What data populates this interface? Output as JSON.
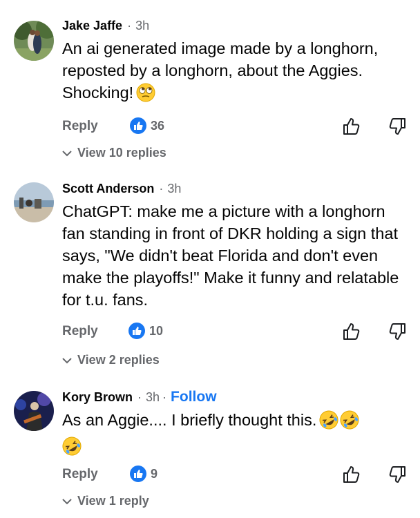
{
  "comments": [
    {
      "author": "Jake Jaffe",
      "time": "3h",
      "text": "An ai generated image made by a longhorn, reposted by a longhorn, about the Aggies. Shocking!",
      "emojis": [
        "face-with-rolling-eyes"
      ],
      "reply_label": "Reply",
      "likes": "36",
      "view_replies": "View 10 replies"
    },
    {
      "author": "Scott Anderson",
      "time": "3h",
      "text": "ChatGPT:  make me a picture with a longhorn fan standing in front of DKR holding a sign that says, \"We didn't beat Florida and don't even make the playoffs!\" Make it funny and relatable for t.u. fans.",
      "reply_label": "Reply",
      "likes": "10",
      "view_replies": "View 2 replies"
    },
    {
      "author": "Kory Brown",
      "time": "3h",
      "follow_label": "Follow",
      "text": "As an Aggie.... I briefly thought this.",
      "emojis": [
        "rolling-on-floor-laughing",
        "rolling-on-floor-laughing",
        "rolling-on-floor-laughing"
      ],
      "reply_label": "Reply",
      "likes": "9",
      "view_replies": "View 1 reply"
    }
  ],
  "colors": {
    "accent": "#1877f2",
    "muted": "#65676b",
    "text": "#050505",
    "emoji": "#ffcc33"
  }
}
